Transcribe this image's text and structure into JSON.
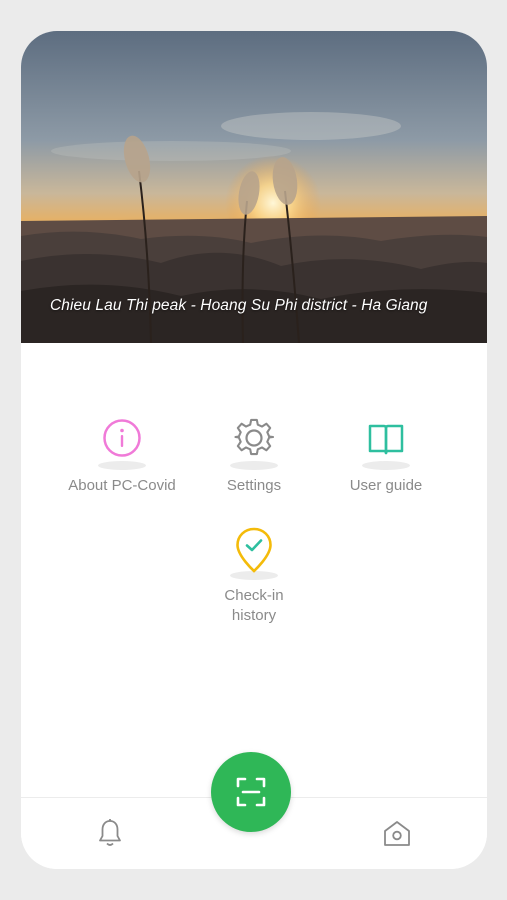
{
  "hero": {
    "caption": "Chieu Lau Thi peak - Hoang Su Phi district - Ha Giang"
  },
  "menu": {
    "items": [
      {
        "label": "About PC-Covid",
        "icon": "info-circle-icon",
        "color": "#f07ad8"
      },
      {
        "label": "Settings",
        "icon": "gear-icon",
        "color": "#8a8a8a"
      },
      {
        "label": "User guide",
        "icon": "open-book-icon",
        "color": "#2ebf9f"
      },
      {
        "label": "Check-in\nhistory",
        "icon": "location-check-icon",
        "color": "#f4bb0a"
      }
    ]
  },
  "bottom_nav": {
    "left_icon": "bell-icon",
    "center_icon": "qr-scan-icon",
    "right_icon": "home-icon",
    "accent": "#2fb757"
  }
}
